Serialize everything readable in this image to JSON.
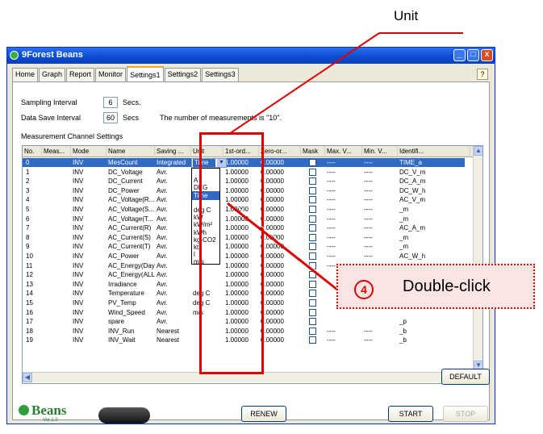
{
  "annotation": {
    "unit_label": "Unit",
    "step_number": "4",
    "callout_text": "Double-click",
    "color": "#e00000"
  },
  "window": {
    "title": "9Forest Beans",
    "controls": [
      "_",
      "□",
      "x"
    ],
    "help_icon": "?"
  },
  "tabs": [
    "Home",
    "Graph",
    "Report",
    "Monitor",
    "Settings1",
    "Settings2",
    "Settings3"
  ],
  "active_tab": "Settings1",
  "settings": {
    "sampling_label": "Sampling Interval",
    "sampling_value": "6",
    "sampling_unit": "Secs.",
    "save_label": "Data Save Interval",
    "save_value": "60",
    "save_unit": "Secs",
    "measurement_note": "The number of measurements is \"10\".",
    "section_title": "Measurement Channel Settings"
  },
  "grid": {
    "headers": [
      "No.",
      "Meas...",
      "Mode",
      "Name",
      "Saving ...",
      "Unit",
      "1st-ord...",
      "Zero-or...",
      "Mask",
      "Max. V...",
      "Min. V...",
      "Identifi..."
    ],
    "rows": [
      {
        "no": "0",
        "mode": "INV",
        "name": "MesCount",
        "saving": "Integrated",
        "unit": "Time",
        "first": "1.00000",
        "zero": "0.00000",
        "max": "----",
        "min": "----",
        "id": "TIME_a"
      },
      {
        "no": "1",
        "mode": "INV",
        "name": "DC_Voltage",
        "saving": "Avr.",
        "unit": "",
        "first": "1.00000",
        "zero": "0.00000",
        "max": "----",
        "min": "----",
        "id": "DC_V_m"
      },
      {
        "no": "2",
        "mode": "INV",
        "name": "DC_Current",
        "saving": "Avr.",
        "unit": "",
        "first": "1.00000",
        "zero": "0.00000",
        "max": "----",
        "min": "----",
        "id": "DC_A_m"
      },
      {
        "no": "3",
        "mode": "INV",
        "name": "DC_Power",
        "saving": "Avr.",
        "unit": "",
        "first": "1.00000",
        "zero": "0.00000",
        "max": "----",
        "min": "----",
        "id": "DC_W_h"
      },
      {
        "no": "4",
        "mode": "INV",
        "name": "AC_Voltage(R...",
        "saving": "Avr.",
        "unit": "",
        "first": "1.00000",
        "zero": "0.00000",
        "max": "----",
        "min": "----",
        "id": "AC_V_m"
      },
      {
        "no": "5",
        "mode": "INV",
        "name": "AC_Voltage(S...",
        "saving": "Avr.",
        "unit": "",
        "first": "1.00000",
        "zero": "0.00000",
        "max": "----",
        "min": "----",
        "id": "_m"
      },
      {
        "no": "6",
        "mode": "INV",
        "name": "AC_Voltage(T...",
        "saving": "Avr.",
        "unit": "",
        "first": "1.00000",
        "zero": "0.00000",
        "max": "----",
        "min": "----",
        "id": "_m"
      },
      {
        "no": "7",
        "mode": "INV",
        "name": "AC_Current(R)",
        "saving": "Avr.",
        "unit": "",
        "first": "1.00000",
        "zero": "0.00000",
        "max": "----",
        "min": "----",
        "id": "AC_A_m"
      },
      {
        "no": "8",
        "mode": "INV",
        "name": "AC_Current(S)",
        "saving": "Avr.",
        "unit": "",
        "first": "1.00000",
        "zero": "0.00000",
        "max": "----",
        "min": "----",
        "id": "_m"
      },
      {
        "no": "9",
        "mode": "INV",
        "name": "AC_Current(T)",
        "saving": "Avr.",
        "unit": "",
        "first": "1.00000",
        "zero": "0.00000",
        "max": "----",
        "min": "----",
        "id": "_m"
      },
      {
        "no": "10",
        "mode": "INV",
        "name": "AC_Power",
        "saving": "Avr.",
        "unit": "",
        "first": "1.00000",
        "zero": "0.00000",
        "max": "----",
        "min": "----",
        "id": "AC_W_h"
      },
      {
        "no": "11",
        "mode": "INV",
        "name": "AC_Energy(Day)",
        "saving": "Avr.",
        "unit": "",
        "first": "1.00000",
        "zero": "0.00000",
        "max": "----",
        "min": "----",
        "id": "_m"
      },
      {
        "no": "12",
        "mode": "INV",
        "name": "AC_Energy(ALL)",
        "saving": "Avr.",
        "unit": "",
        "first": "1.00000",
        "zero": "0.00000",
        "max": "",
        "min": "",
        "id": ""
      },
      {
        "no": "13",
        "mode": "INV",
        "name": "Irradiance",
        "saving": "Avr.",
        "unit": "",
        "first": "1.00000",
        "zero": "0.00000",
        "max": "",
        "min": "",
        "id": ""
      },
      {
        "no": "14",
        "mode": "INV",
        "name": "Temperature",
        "saving": "Avr.",
        "unit": "deg C",
        "first": "1.00000",
        "zero": "0.00000",
        "max": "",
        "min": "",
        "id": ""
      },
      {
        "no": "15",
        "mode": "INV",
        "name": "PV_Temp",
        "saving": "Avr.",
        "unit": "deg C",
        "first": "1.00000",
        "zero": "0.00000",
        "max": "",
        "min": "",
        "id": ""
      },
      {
        "no": "16",
        "mode": "INV",
        "name": "Wind_Speed",
        "saving": "Avr.",
        "unit": "m/s",
        "first": "1.00000",
        "zero": "0.00000",
        "max": "",
        "min": "",
        "id": ""
      },
      {
        "no": "17",
        "mode": "INV",
        "name": "spare",
        "saving": "Avr.",
        "unit": "",
        "first": "1.00000",
        "zero": "0.00000",
        "max": "",
        "min": "",
        "id": "_p"
      },
      {
        "no": "18",
        "mode": "INV",
        "name": "INV_Run",
        "saving": "Nearest",
        "unit": "",
        "first": "1.00000",
        "zero": "0.00000",
        "max": "----",
        "min": "----",
        "id": "_b"
      },
      {
        "no": "19",
        "mode": "INV",
        "name": "INV_Wait",
        "saving": "Nearest",
        "unit": "",
        "first": "1.00000",
        "zero": "0.00000",
        "max": "----",
        "min": "----",
        "id": "_b"
      }
    ]
  },
  "unit_dropdown": {
    "selected": "Time",
    "options": [
      "",
      "A",
      "DEG",
      "Time",
      "",
      "deg C",
      "kW",
      "kW/m²",
      "kWh",
      "kg-CO2",
      "kt",
      "l",
      "m/s"
    ],
    "highlighted_index": 3
  },
  "buttons": {
    "default": "DEFAULT",
    "renew": "RENEW",
    "start": "START",
    "stop": "STOP"
  },
  "logo": {
    "text": "Beans",
    "version": "Ver.1.0"
  }
}
